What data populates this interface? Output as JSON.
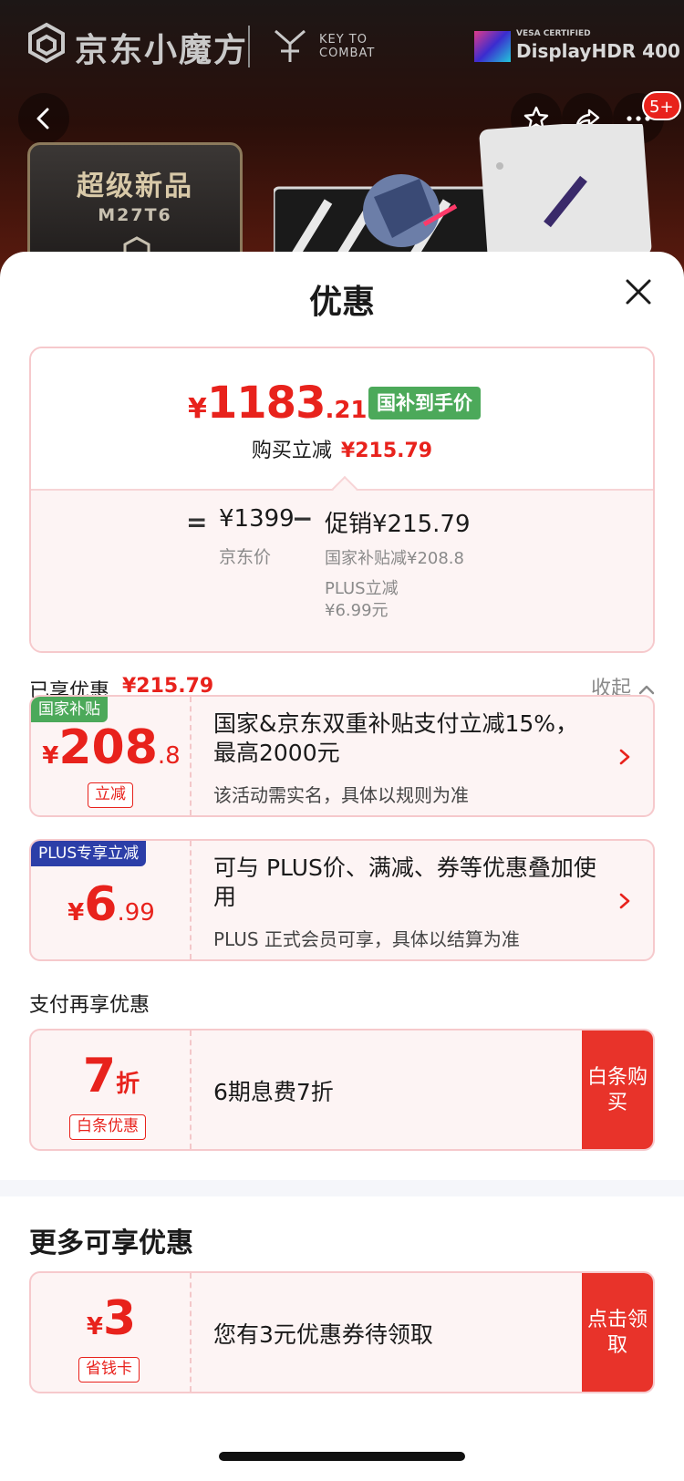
{
  "hero": {
    "brand_name": "京东小魔方",
    "ktc_text_line1": "KEY TO",
    "ktc_text_line2": "COMBAT",
    "hdr_vesa": "VESA CERTIFIED",
    "hdr_text": "DisplayHDR 400",
    "more_badge": "5+",
    "newtag_title": "超级新品",
    "newtag_model": "M27T6"
  },
  "sheet": {
    "title": "优惠"
  },
  "price_card": {
    "symbol": "¥",
    "final_int": "1183",
    "final_dec": ".21",
    "final_tag": "国补到手价",
    "save_label": "购买立减",
    "save_amount": "¥215.79",
    "eq_sign": "=",
    "jd_price": "¥1399",
    "jd_label": "京东价",
    "minus_sign": "−",
    "promo_price": "促销¥215.79",
    "promo_sub1": "国家补贴减¥208.8",
    "promo_sub2_line1": "PLUS立减",
    "promo_sub2_line2": "¥6.99元"
  },
  "enjoyed": {
    "label": "已享优惠",
    "amount": "¥215.79",
    "collapse": "收起"
  },
  "coupons": [
    {
      "tag": "国家补贴",
      "symbol": "¥",
      "int": "208",
      "dec": ".8",
      "chip": "立减",
      "main": "国家&京东双重补贴支付立减15%，最高2000元",
      "sub": "该活动需实名，具体以规则为准"
    },
    {
      "tag": "PLUS专享立减",
      "symbol": "¥",
      "int": "6",
      "dec": ".99",
      "main": "可与 PLUS价、满减、券等优惠叠加使用",
      "sub": "PLUS 正式会员可享，具体以结算为准"
    }
  ],
  "pay_more": {
    "label": "支付再享优惠",
    "int": "7",
    "unit": "折",
    "chip": "白条优惠",
    "main": "6期息费7折",
    "cta": "白条购买"
  },
  "more_offers": {
    "title": "更多可享优惠",
    "symbol": "¥",
    "int": "3",
    "chip": "省钱卡",
    "main": "您有3元优惠券待领取",
    "cta": "点击领取"
  },
  "colors": {
    "accent_red": "#e8221c",
    "green_tag": "#4ca95a",
    "blue_tag": "#2c3ea8"
  }
}
